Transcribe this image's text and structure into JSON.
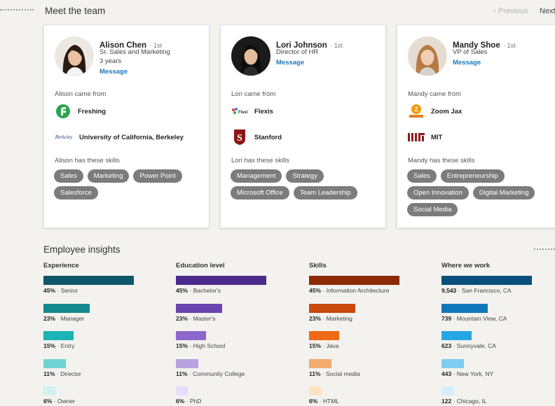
{
  "header": {
    "title": "Meet the team",
    "previous_label": "Previous",
    "next_label": "Next"
  },
  "team": [
    {
      "name": "Alison Chen",
      "degree": "· 1st",
      "title": "Sr. Sales and Marketing",
      "tenure": "3 years",
      "message_label": "Message",
      "came_from_label": "Alison came from",
      "companies": [
        {
          "name": "Freshing",
          "icon": "freshing-logo-icon"
        },
        {
          "name": "University of California, Berkeley",
          "icon": "berkeley-logo-icon"
        }
      ],
      "skills_label": "Alison has these skills",
      "skills": [
        "Sales",
        "Marketing",
        "Power Point",
        "Salesforce"
      ]
    },
    {
      "name": "Lori Johnson",
      "degree": "· 1st",
      "title": "Director of HR",
      "tenure": "",
      "message_label": "Message",
      "came_from_label": "Lori came from",
      "companies": [
        {
          "name": "Flexis",
          "icon": "flexis-logo-icon"
        },
        {
          "name": "Stanford",
          "icon": "stanford-logo-icon"
        }
      ],
      "skills_label": "Lori has these skills",
      "skills": [
        "Management",
        "Strategy",
        "Microsoft Office",
        "Team Leadership"
      ]
    },
    {
      "name": "Mandy Shoe",
      "degree": "· 1st",
      "title": "VP of Sales",
      "tenure": "",
      "message_label": "Message",
      "came_from_label": "Mandy came from",
      "companies": [
        {
          "name": "Zoom Jax",
          "icon": "zoomjax-logo-icon"
        },
        {
          "name": "MIT",
          "icon": "mit-logo-icon"
        }
      ],
      "skills_label": "Mandy has these skills",
      "skills": [
        "Sales",
        "Entrepreneurship",
        "Open Innovation",
        "Digital Marketing",
        "Social Media"
      ]
    }
  ],
  "insights": {
    "title": "Employee insights",
    "columns": [
      {
        "heading": "Experience",
        "colors": [
          "#0f5668",
          "#138a8e",
          "#1bb3b3",
          "#6fd3d3",
          "#d2f1f0"
        ],
        "rows": [
          {
            "value": "45%",
            "label": "· Senior",
            "fraction": 0.45
          },
          {
            "value": "23%",
            "label": "· Manager",
            "fraction": 0.23
          },
          {
            "value": "15%",
            "label": "· Entry",
            "fraction": 0.15
          },
          {
            "value": "11%",
            "label": "· Director",
            "fraction": 0.11
          },
          {
            "value": "6%",
            "label": "· Owner",
            "fraction": 0.06
          }
        ]
      },
      {
        "heading": "Education level",
        "colors": [
          "#4b2a8c",
          "#6a45b0",
          "#8c68cc",
          "#b9a2e0",
          "#e6ddf7"
        ],
        "rows": [
          {
            "value": "45%",
            "label": "· Bachelor's",
            "fraction": 0.45
          },
          {
            "value": "23%",
            "label": "· Master's",
            "fraction": 0.23
          },
          {
            "value": "15%",
            "label": "· High School",
            "fraction": 0.15
          },
          {
            "value": "11%",
            "label": "· Community College",
            "fraction": 0.11
          },
          {
            "value": "6%",
            "label": "· PhD",
            "fraction": 0.06
          }
        ]
      },
      {
        "heading": "Skills",
        "colors": [
          "#8f2a06",
          "#c94a0c",
          "#ee6a16",
          "#f3ab6e",
          "#fde2c2"
        ],
        "rows": [
          {
            "value": "45%",
            "label": "· Information Architecture",
            "fraction": 0.45
          },
          {
            "value": "23%",
            "label": "· Marketing",
            "fraction": 0.23
          },
          {
            "value": "15%",
            "label": "· Java",
            "fraction": 0.15
          },
          {
            "value": "11%",
            "label": "· Social media",
            "fraction": 0.11
          },
          {
            "value": "6%",
            "label": "· HTML",
            "fraction": 0.06
          }
        ]
      },
      {
        "heading": "Where we work",
        "colors": [
          "#0a4f7b",
          "#0f78bb",
          "#26a6e4",
          "#7fcdf0",
          "#d4eefb"
        ],
        "rows": [
          {
            "value": "9,543",
            "label": "· San Francisco, CA",
            "fraction": 0.45
          },
          {
            "value": "739",
            "label": "· Mountain View, CA",
            "fraction": 0.23
          },
          {
            "value": "623",
            "label": "· Sunnyvale, CA",
            "fraction": 0.15
          },
          {
            "value": "443",
            "label": "· New York, NY",
            "fraction": 0.11
          },
          {
            "value": "122",
            "label": "· Chicago, IL",
            "fraction": 0.06
          }
        ]
      }
    ]
  }
}
